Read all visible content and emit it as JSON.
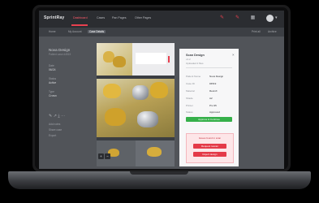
{
  "app": {
    "brand": "SprintRay"
  },
  "topnav": {
    "items": [
      "Dashboard",
      "Cases",
      "Pan Pages",
      "Other Pages"
    ]
  },
  "toolbar_icons": [
    "pen-icon",
    "pen-icon",
    "grid-icon",
    "avatar",
    "menu-icon"
  ],
  "breadcrumb": {
    "items": [
      "Home",
      "My Account",
      "Case Details"
    ],
    "right": [
      "Print all",
      "Archive"
    ]
  },
  "sidebar": {
    "title": "Nova Design",
    "subtitle": "Patient case #4519",
    "fields": [
      {
        "label": "Date",
        "value": "06/24"
      },
      {
        "label": "Status",
        "value": "Active"
      },
      {
        "label": "Type",
        "value": "Crown"
      }
    ],
    "links": [
      "Add notes",
      "Share case",
      "Export"
    ]
  },
  "gallery": {
    "zoom_in": "+",
    "zoom_out": "−"
  },
  "panel": {
    "title": "Scan Design",
    "subtitle": "v1.2",
    "meta": "Uploaded 2 files",
    "close": "×",
    "fields": [
      {
        "label": "Patient Name",
        "value": "Nova Design"
      },
      {
        "label": "Case ID",
        "value": "#4519"
      },
      {
        "label": "Material",
        "value": "ResinX"
      },
      {
        "label": "Shade",
        "value": "A2"
      },
      {
        "label": "Printer",
        "value": "Pro 95"
      },
      {
        "label": "Status",
        "value": "Approved"
      }
    ],
    "primary_action": "Approve & Continue",
    "alert": {
      "title": "Issues found in scan",
      "actions": [
        "Request rescan",
        "Reject design"
      ]
    }
  },
  "colors": {
    "accent": "#e8404f",
    "success": "#36b04a",
    "chrome": "#2b2d31"
  }
}
